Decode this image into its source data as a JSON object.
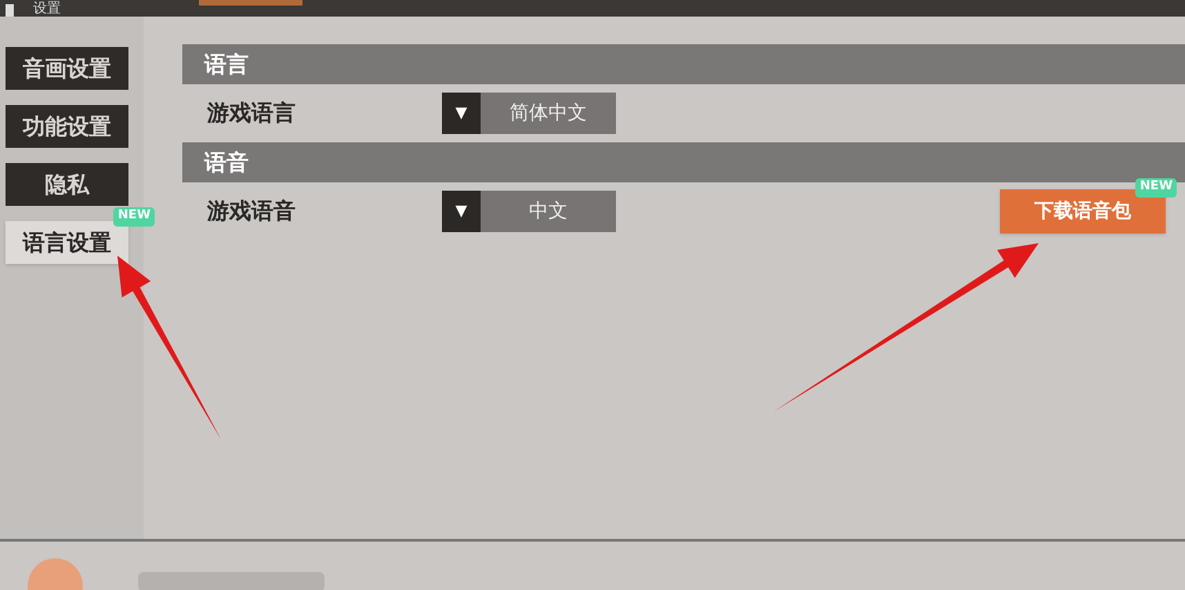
{
  "window": {
    "title": "设置"
  },
  "sidebar": {
    "items": [
      {
        "label": "音画设置",
        "selected": false
      },
      {
        "label": "功能设置",
        "selected": false
      },
      {
        "label": "隐私",
        "selected": false
      },
      {
        "label": "语言设置",
        "selected": true,
        "badge": "NEW"
      }
    ]
  },
  "sections": [
    {
      "title": "语言",
      "rows": [
        {
          "kind": "dropdown",
          "label": "游戏语言",
          "caret": "▼",
          "value": "简体中文"
        }
      ]
    },
    {
      "title": "语音",
      "rows": [
        {
          "kind": "dropdown",
          "label": "游戏语音",
          "caret": "▼",
          "value": "中文",
          "action": {
            "label": "下载语音包",
            "badge": "NEW"
          }
        }
      ]
    }
  ]
}
